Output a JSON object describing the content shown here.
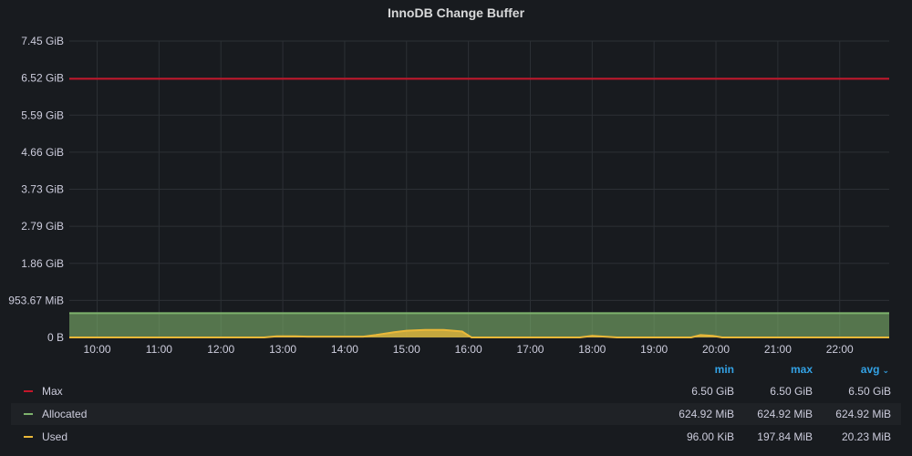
{
  "panel": {
    "title": "InnoDB Change Buffer"
  },
  "chart_data": {
    "type": "area",
    "title": "InnoDB Change Buffer",
    "y_ticks": [
      "0 B",
      "953.67 MiB",
      "1.86 GiB",
      "2.79 GiB",
      "3.73 GiB",
      "4.66 GiB",
      "5.59 GiB",
      "6.52 GiB",
      "7.45 GiB"
    ],
    "x_ticks": [
      "10:00",
      "11:00",
      "12:00",
      "13:00",
      "14:00",
      "15:00",
      "16:00",
      "17:00",
      "18:00",
      "19:00",
      "20:00",
      "21:00",
      "22:00"
    ],
    "ylim_gib": [
      0,
      7.45
    ],
    "xlim_hours": [
      9.55,
      22.8
    ],
    "grid": true,
    "series": [
      {
        "name": "Max",
        "color": "#c4162a",
        "points": [
          [
            9.55,
            6.5
          ],
          [
            22.8,
            6.5
          ]
        ]
      },
      {
        "name": "Allocated",
        "color": "#7eb26d",
        "fill": true,
        "points": [
          [
            9.55,
            0.61
          ],
          [
            22.8,
            0.61
          ]
        ]
      },
      {
        "name": "Used",
        "color": "#eab839",
        "fill": true,
        "points": [
          [
            9.55,
            0.0
          ],
          [
            12.7,
            0.0
          ],
          [
            12.9,
            0.03
          ],
          [
            13.2,
            0.03
          ],
          [
            13.4,
            0.02
          ],
          [
            14.3,
            0.02
          ],
          [
            14.5,
            0.06
          ],
          [
            14.8,
            0.13
          ],
          [
            15.0,
            0.17
          ],
          [
            15.3,
            0.19
          ],
          [
            15.6,
            0.19
          ],
          [
            15.9,
            0.15
          ],
          [
            16.05,
            0.0
          ],
          [
            17.8,
            0.0
          ],
          [
            18.0,
            0.04
          ],
          [
            18.2,
            0.02
          ],
          [
            18.4,
            0.0
          ],
          [
            19.6,
            0.0
          ],
          [
            19.75,
            0.06
          ],
          [
            19.95,
            0.04
          ],
          [
            20.1,
            0.0
          ],
          [
            22.8,
            0.0
          ]
        ]
      }
    ]
  },
  "legend": {
    "headers": {
      "min": "min",
      "max": "max",
      "avg": "avg"
    },
    "rows": [
      {
        "name": "Max",
        "color": "#c4162a",
        "min": "6.50 GiB",
        "max": "6.50 GiB",
        "avg": "6.50 GiB"
      },
      {
        "name": "Allocated",
        "color": "#7eb26d",
        "min": "624.92 MiB",
        "max": "624.92 MiB",
        "avg": "624.92 MiB"
      },
      {
        "name": "Used",
        "color": "#eab839",
        "min": "96.00 KiB",
        "max": "197.84 MiB",
        "avg": "20.23 MiB"
      }
    ]
  }
}
